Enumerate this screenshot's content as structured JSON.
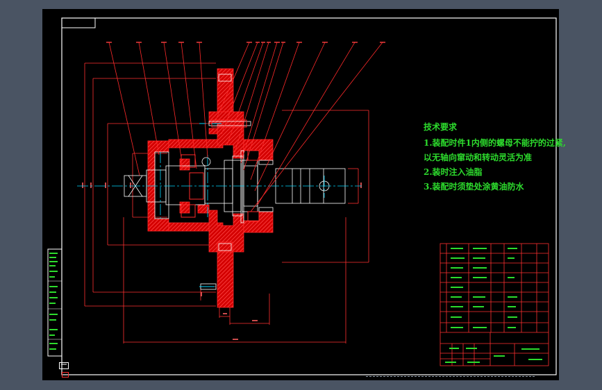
{
  "tech_requirements": {
    "title": "技术要求",
    "lines": [
      "1.装配时件1内侧的螺母不能拧的过紧,",
      "  以无轴向窜动和转动灵活为准",
      "2.装时注入油脂",
      "3.装配时须垫处涂黄油防水"
    ]
  },
  "colors": {
    "background": "#000000",
    "frame": "#ffffff",
    "part_outline": "#ff2a2a",
    "section_hatch": "#ff0000",
    "dimension": "#ff3030",
    "center_line": "#00d8ff",
    "title_block": "#ff3030",
    "text": "#2ddc2d",
    "status_bar": "#4a5463"
  },
  "icons": [
    "cad-model-space-icon",
    "cad-layout-tab-icon"
  ]
}
